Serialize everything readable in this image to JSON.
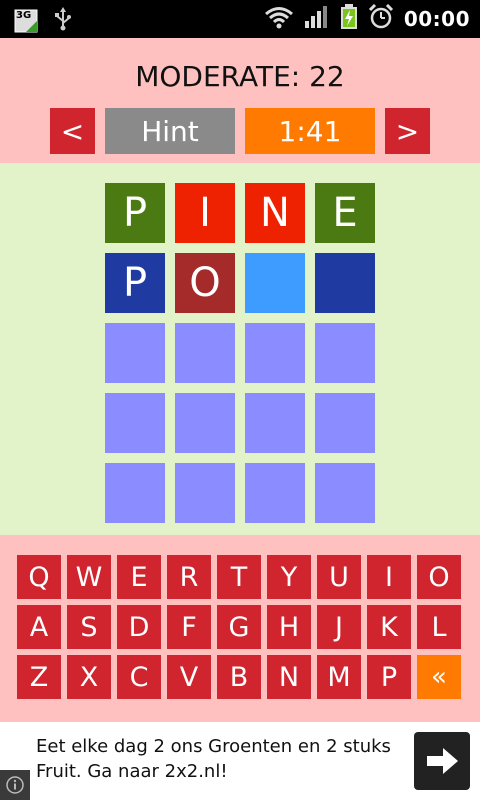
{
  "statusbar": {
    "network": "3G",
    "time": "00:00"
  },
  "header": {
    "title": "MODERATE: 22",
    "prev_label": "<",
    "hint_label": "Hint",
    "timer": "1:41",
    "next_label": ">"
  },
  "board": {
    "rows": [
      [
        {
          "letter": "P",
          "color": "#4b7a13"
        },
        {
          "letter": "I",
          "color": "#ee2200"
        },
        {
          "letter": "N",
          "color": "#ee2200"
        },
        {
          "letter": "E",
          "color": "#4b7a13"
        }
      ],
      [
        {
          "letter": "P",
          "color": "#1f3aa0"
        },
        {
          "letter": "O",
          "color": "#a52a2a"
        },
        {
          "letter": "",
          "color": "#3e9bff"
        },
        {
          "letter": "",
          "color": "#1f3aa0"
        }
      ],
      [
        {
          "letter": "",
          "color": "#8a8cff"
        },
        {
          "letter": "",
          "color": "#8a8cff"
        },
        {
          "letter": "",
          "color": "#8a8cff"
        },
        {
          "letter": "",
          "color": "#8a8cff"
        }
      ],
      [
        {
          "letter": "",
          "color": "#8a8cff"
        },
        {
          "letter": "",
          "color": "#8a8cff"
        },
        {
          "letter": "",
          "color": "#8a8cff"
        },
        {
          "letter": "",
          "color": "#8a8cff"
        }
      ],
      [
        {
          "letter": "",
          "color": "#8a8cff"
        },
        {
          "letter": "",
          "color": "#8a8cff"
        },
        {
          "letter": "",
          "color": "#8a8cff"
        },
        {
          "letter": "",
          "color": "#8a8cff"
        }
      ]
    ]
  },
  "keyboard": {
    "rows": [
      [
        "Q",
        "W",
        "E",
        "R",
        "T",
        "Y",
        "U",
        "I",
        "O"
      ],
      [
        "A",
        "S",
        "D",
        "F",
        "G",
        "H",
        "J",
        "K",
        "L"
      ],
      [
        "Z",
        "X",
        "C",
        "V",
        "B",
        "N",
        "M",
        "P",
        "«"
      ]
    ]
  },
  "ad": {
    "text": "Eet elke dag 2 ons Groenten en 2 stuks Fruit. Ga naar 2x2.nl!"
  },
  "colors": {
    "header_bg": "#ffc0c0",
    "board_bg": "#e2f2c9",
    "key_red": "#d0242f",
    "accent_orange": "#ff7a00",
    "hint_gray": "#8a8a8a"
  }
}
